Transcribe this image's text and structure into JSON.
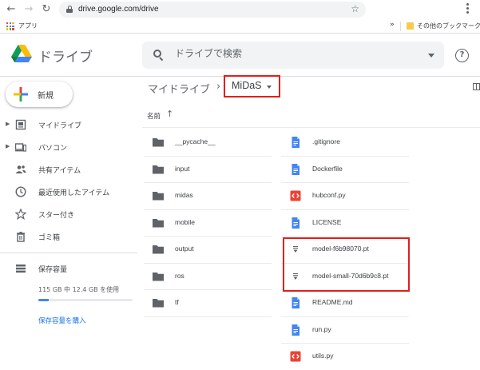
{
  "browser": {
    "url": "drive.google.com/drive",
    "apps_label": "アプリ",
    "bookmarks_more": "»",
    "other_bookmarks": "その他のブックマーク"
  },
  "header": {
    "app_name": "ドライブ",
    "search_placeholder": "ドライブで検索",
    "help": "?"
  },
  "sidebar": {
    "new_label": "新規",
    "items": [
      {
        "label": "マイドライブ",
        "icon": "my-drive-icon",
        "expandable": true
      },
      {
        "label": "パソコン",
        "icon": "computer-icon",
        "expandable": true
      },
      {
        "label": "共有アイテム",
        "icon": "shared-icon",
        "expandable": false
      },
      {
        "label": "最近使用したアイテム",
        "icon": "clock-icon",
        "expandable": false
      },
      {
        "label": "スター付き",
        "icon": "star-icon",
        "expandable": false
      },
      {
        "label": "ゴミ箱",
        "icon": "trash-icon",
        "expandable": false
      }
    ],
    "storage": {
      "label": "保存容量",
      "usage_text": "115 GB 中 12.4 GB を使用",
      "used_fraction": 0.108,
      "buy_link": "保存容量を購入"
    }
  },
  "breadcrumb": {
    "root": "マイドライブ",
    "separator": "›",
    "current": "MiDaS"
  },
  "sort": {
    "label": "名前",
    "arrow": "↑"
  },
  "files": {
    "folders": [
      "__pycache__",
      "input",
      "midas",
      "mobile",
      "output",
      "ros",
      "tf"
    ],
    "items": [
      {
        "name": ".gitignore",
        "type": "doc"
      },
      {
        "name": "Dockerfile",
        "type": "doc"
      },
      {
        "name": "hubconf.py",
        "type": "code"
      },
      {
        "name": "LICENSE",
        "type": "doc"
      },
      {
        "name": "model-f6b98070.pt",
        "type": "binary"
      },
      {
        "name": "model-small-70d6b9c8.pt",
        "type": "binary"
      },
      {
        "name": "README.md",
        "type": "doc"
      },
      {
        "name": "run.py",
        "type": "doc"
      },
      {
        "name": "utils.py",
        "type": "code"
      }
    ]
  },
  "colors": {
    "highlight": "#e0201a",
    "folder": "#5f6368",
    "doc": "#4285f4",
    "code": "#ea4335",
    "link": "#1a73e8"
  }
}
